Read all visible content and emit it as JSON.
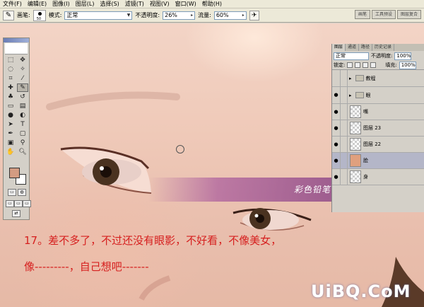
{
  "menubar": [
    "文件(F)",
    "编辑(E)",
    "图像(I)",
    "图层(L)",
    "选择(S)",
    "滤镜(T)",
    "视图(V)",
    "窗口(W)",
    "帮助(H)"
  ],
  "options": {
    "brush_label": "画笔:",
    "brush_size": "50",
    "mode_label": "模式:",
    "mode_value": "正常",
    "opacity_label": "不透明度:",
    "opacity_value": "26%",
    "flow_label": "流量:",
    "flow_value": "60%",
    "palette_tabs": [
      "画笔",
      "工具预设",
      "图层复合"
    ]
  },
  "layers_panel": {
    "tabs": [
      "图层",
      "通道",
      "路径",
      "历史记录"
    ],
    "blend_mode": "正常",
    "opacity_label": "不透明度:",
    "opacity_value": "100%",
    "lock_label": "锁定:",
    "fill_label": "填充:",
    "fill_value": "100%",
    "layers": [
      {
        "name": "教程",
        "type": "group",
        "visible": false
      },
      {
        "name": "眼",
        "type": "group",
        "visible": true
      },
      {
        "name": "嘴",
        "type": "layer",
        "visible": true
      },
      {
        "name": "图层 23",
        "type": "layer",
        "visible": true
      },
      {
        "name": "图层 22",
        "type": "layer",
        "visible": true
      },
      {
        "name": "脸",
        "type": "layer",
        "visible": true,
        "selected": true
      },
      {
        "name": "身",
        "type": "layer",
        "visible": true
      }
    ]
  },
  "banner_text": "彩色铅笔 - 渍 原创教程",
  "caption_line1": "17。差不多了，不过还没有眼影，不好看，不像美女，",
  "caption_line2": "像---------，自己想吧-------",
  "watermark": "UiBQ.CoM",
  "colors": {
    "foreground": "#d39c82",
    "background": "#ffffff",
    "caption": "#d6201f"
  }
}
